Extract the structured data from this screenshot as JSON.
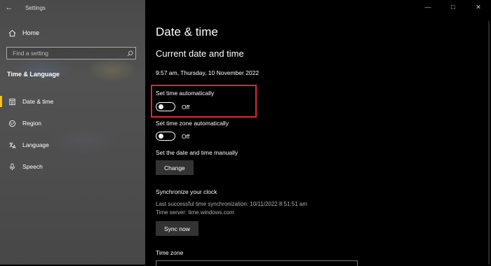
{
  "window": {
    "app_title": "Settings",
    "back_icon": "back-arrow-icon",
    "controls": [
      "minimize-icon",
      "maximize-icon",
      "close-icon"
    ]
  },
  "sidebar": {
    "home_label": "Home",
    "search_placeholder": "Find a setting",
    "section_title": "Time & Language",
    "items": [
      {
        "label": "Date & time",
        "icon": "date-time-icon",
        "selected": true
      },
      {
        "label": "Region",
        "icon": "region-icon",
        "selected": false
      },
      {
        "label": "Language",
        "icon": "language-icon",
        "selected": false
      },
      {
        "label": "Speech",
        "icon": "microphone-icon",
        "selected": false
      }
    ],
    "accent_color": "#f0c419"
  },
  "main": {
    "title": "Date & time",
    "subheading": "Current date and time",
    "current_datetime": "9:57 am, Thursday, 10 November 2022",
    "set_time_auto": {
      "label": "Set time automatically",
      "state": "Off"
    },
    "set_timezone_auto": {
      "label": "Set time zone automatically",
      "state": "Off"
    },
    "manual": {
      "label": "Set the date and time manually",
      "button": "Change"
    },
    "sync": {
      "heading": "Synchronize your clock",
      "last_sync": "Last successful time synchronization: 10/11/2022 8:51:51 am",
      "time_server": "Time server: time.windows.com",
      "button": "Sync now"
    },
    "timezone_label": "Time zone",
    "highlight_color": "#e0282e"
  }
}
